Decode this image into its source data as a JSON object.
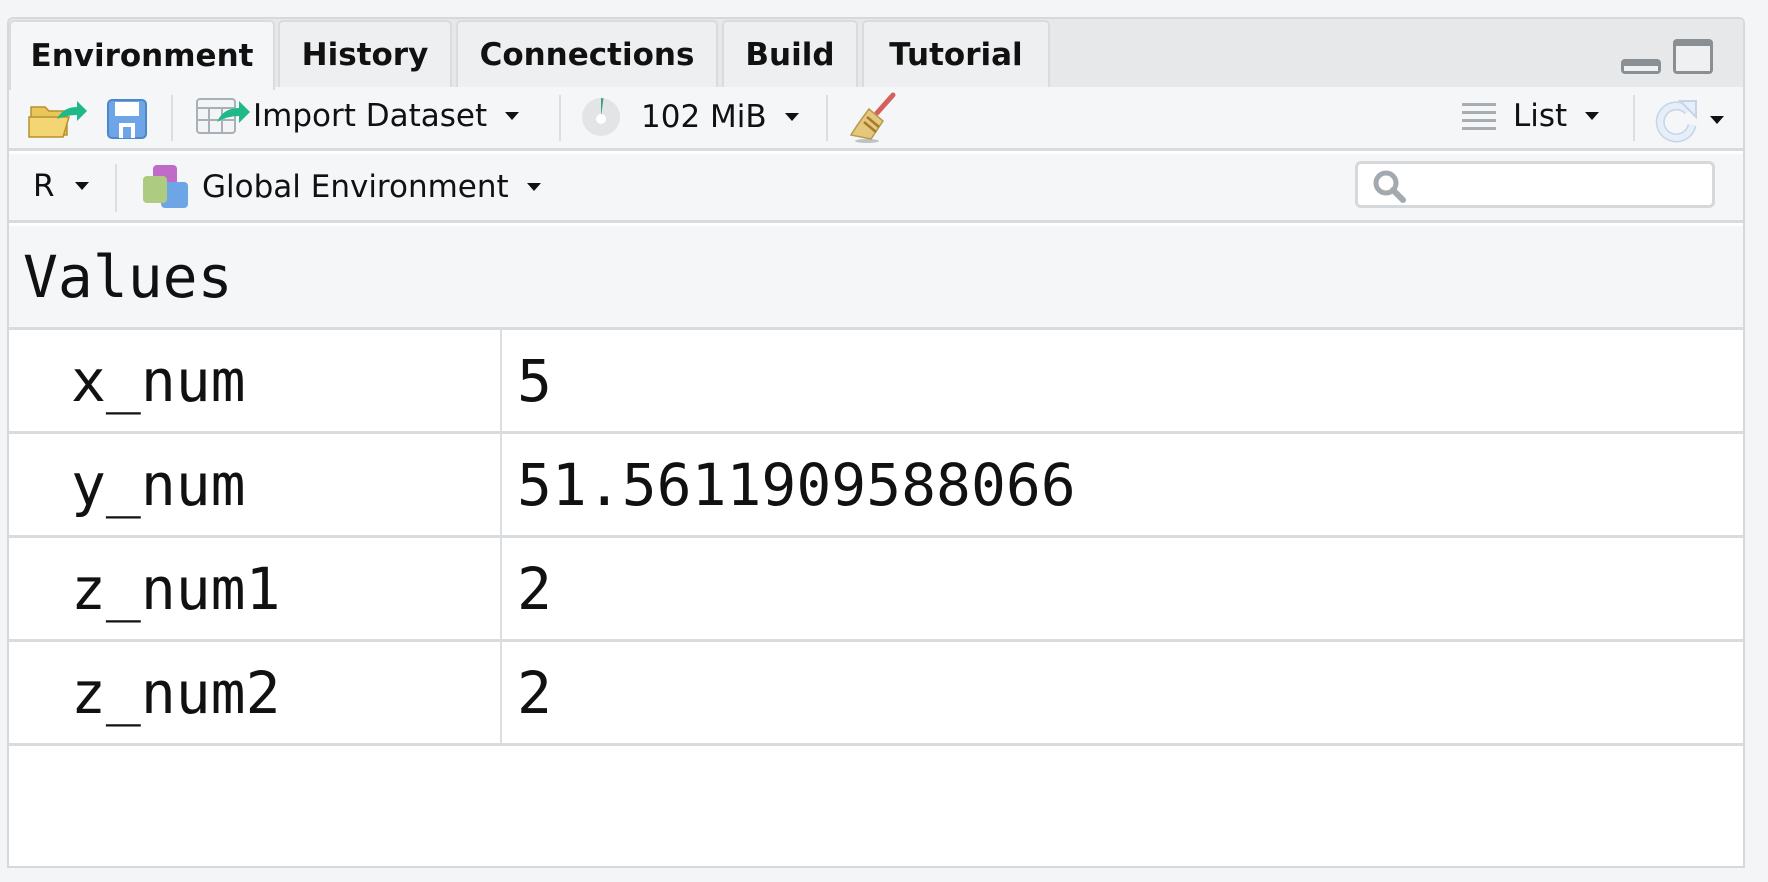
{
  "tabs": [
    {
      "label": "Environment",
      "active": true
    },
    {
      "label": "History",
      "active": false
    },
    {
      "label": "Connections",
      "active": false
    },
    {
      "label": "Build",
      "active": false
    },
    {
      "label": "Tutorial",
      "active": false
    }
  ],
  "window_controls": {
    "minimize": "minimize-icon",
    "maximize": "maximize-icon"
  },
  "toolbar": {
    "open_icon": "open-folder-icon",
    "save_icon": "save-disk-icon",
    "import_dataset_label": "Import Dataset",
    "memory_label": "102 MiB",
    "memory_usage_fraction": 0.02,
    "clear_icon": "broom-icon",
    "view_mode_label": "List",
    "refresh_icon": "refresh-icon"
  },
  "env_bar": {
    "language_label": "R",
    "environment_label": "Global Environment",
    "search_placeholder": "",
    "search_value": ""
  },
  "section_title": "Values",
  "variables": [
    {
      "name": "x_num",
      "value": "5"
    },
    {
      "name": "y_num",
      "value": "51.5611909588066"
    },
    {
      "name": "z_num1",
      "value": "2"
    },
    {
      "name": "z_num2",
      "value": "2"
    }
  ],
  "colors": {
    "accent_green": "#1fb889",
    "env_icon_purple": "#bf6cc8",
    "env_icon_green": "#aecb82",
    "env_icon_blue": "#6ea5e6"
  }
}
